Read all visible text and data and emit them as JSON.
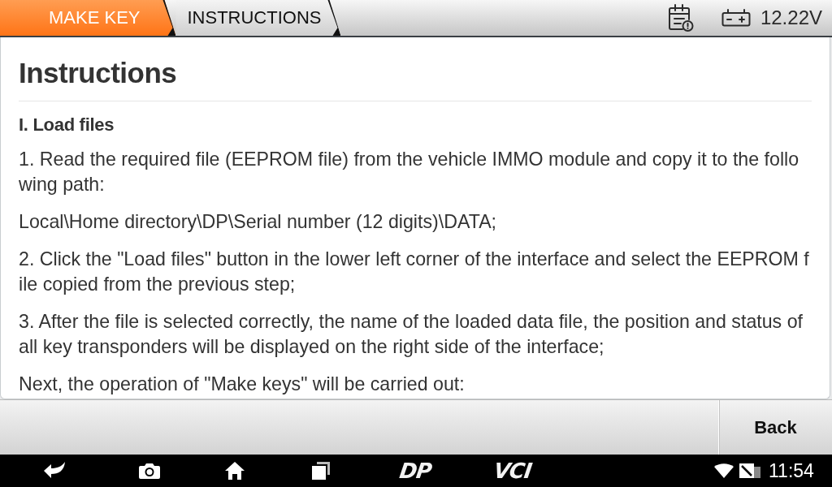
{
  "breadcrumbs": [
    {
      "label": "MAKE KEY",
      "selected": true
    },
    {
      "label": "INSTRUCTIONS",
      "selected": false
    }
  ],
  "status": {
    "voltage": "12.22V"
  },
  "document": {
    "title": "Instructions",
    "sections": [
      {
        "heading": "I. Load files",
        "paragraphs": [
          "1. Read the required file (EEPROM file) from the vehicle IMMO module and copy it to the following path:",
          "Local\\Home directory\\DP\\Serial number (12 digits)\\DATA;",
          "2. Click the \"Load files\" button in the lower left corner of the interface and select the EEPROM file copied from the previous step;",
          "3. After the file is selected correctly, the name of the loaded data file, the position and status of all key transponders will be displayed on the right side of the interface;",
          "Next, the operation of \"Make keys\" will be carried out:"
        ]
      }
    ]
  },
  "footer": {
    "buttons": [
      "Back"
    ]
  },
  "system_bar": {
    "logos": [
      "DP",
      "VCI"
    ],
    "time": "11:54"
  }
}
